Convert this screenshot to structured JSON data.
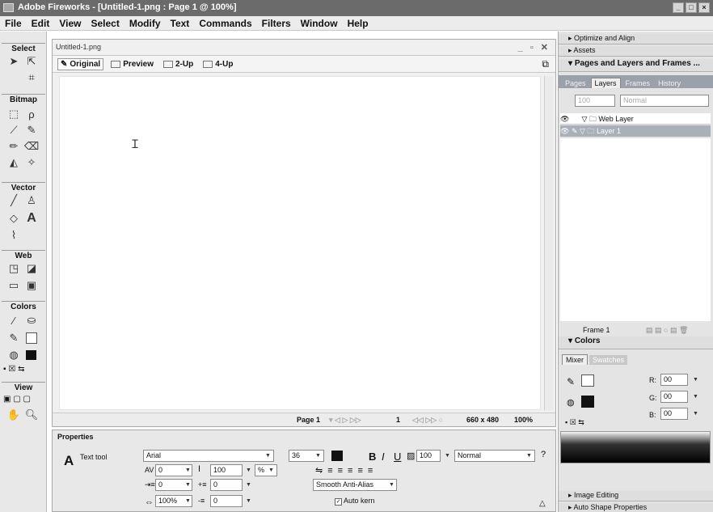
{
  "window": {
    "title": "Adobe Fireworks - [Untitled-1.png : Page 1 @ 100%]",
    "controls": [
      "_",
      "□",
      "×"
    ]
  },
  "menu": [
    "File",
    "Edit",
    "View",
    "Select",
    "Modify",
    "Text",
    "Commands",
    "Filters",
    "Window",
    "Help"
  ],
  "tools": {
    "sections": [
      "Select",
      "Bitmap",
      "Vector",
      "Web",
      "Colors",
      "View"
    ],
    "text_tool_glyph": "A"
  },
  "document": {
    "tab": "Untitled-1.png",
    "view_tabs": [
      "Original",
      "Preview",
      "2-Up",
      "4-Up"
    ],
    "status": {
      "page": "Page 1",
      "frame": "1",
      "size": "660 x 480",
      "zoom": "100%"
    }
  },
  "properties": {
    "header": "Properties",
    "tool_name": "Text tool",
    "font": "Arial",
    "font_size": "36",
    "kerning": "0",
    "leading": "100",
    "leading_unit": "%",
    "opacity": "100",
    "blend_mode": "Normal",
    "indent": "0",
    "space_before": "0",
    "horizontal_scale": "100%",
    "space_after": "0",
    "anti_alias": "Smooth Anti-Alias",
    "auto_kern_label": "Auto kern",
    "bold": "B",
    "italic": "I",
    "underline": "U"
  },
  "right_panels": {
    "optimize": "Optimize and Align",
    "assets": "Assets",
    "pages_layers": "Pages and Layers and Frames ...",
    "tabs": [
      "Pages",
      "Layers",
      "Frames",
      "History"
    ],
    "opacity": "100",
    "blend": "Normal",
    "layers": [
      "Web Layer",
      "Layer 1"
    ],
    "frame_label": "Frame 1",
    "colors_header": "Colors",
    "color_tabs": [
      "Mixer",
      "Swatches"
    ],
    "rgb": {
      "r": "00",
      "g": "00",
      "b": "00",
      "r_label": "R:",
      "g_label": "G:",
      "b_label": "B:"
    },
    "image_editing": "Image Editing",
    "auto_shape": "Auto Shape Properties"
  },
  "colors": {
    "titlebar": "#6b6b6b",
    "panel_tabs": "#9aa1aa",
    "stroke": "#111111",
    "fill": "#111111"
  }
}
